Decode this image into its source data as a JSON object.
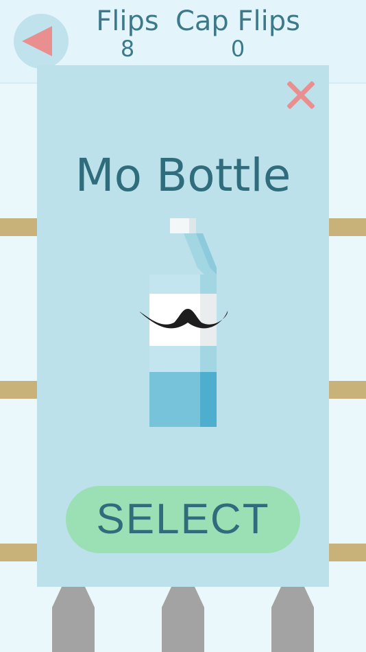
{
  "header": {
    "flips_label": "Flips",
    "flips_value": "8",
    "cap_flips_label": "Cap Flips",
    "cap_flips_value": "0"
  },
  "back_button": {
    "icon": "back-arrow-icon"
  },
  "modal": {
    "title": "Mo Bottle",
    "select_label": "SELECT",
    "close_icon": "close-icon",
    "bottle_item": "mustache-bottle"
  },
  "colors": {
    "accent": "#e98f8f",
    "button_green": "#9be0b4",
    "text": "#2f6d7d",
    "card": "#bde1ea",
    "shelf": "#c8b27a"
  }
}
